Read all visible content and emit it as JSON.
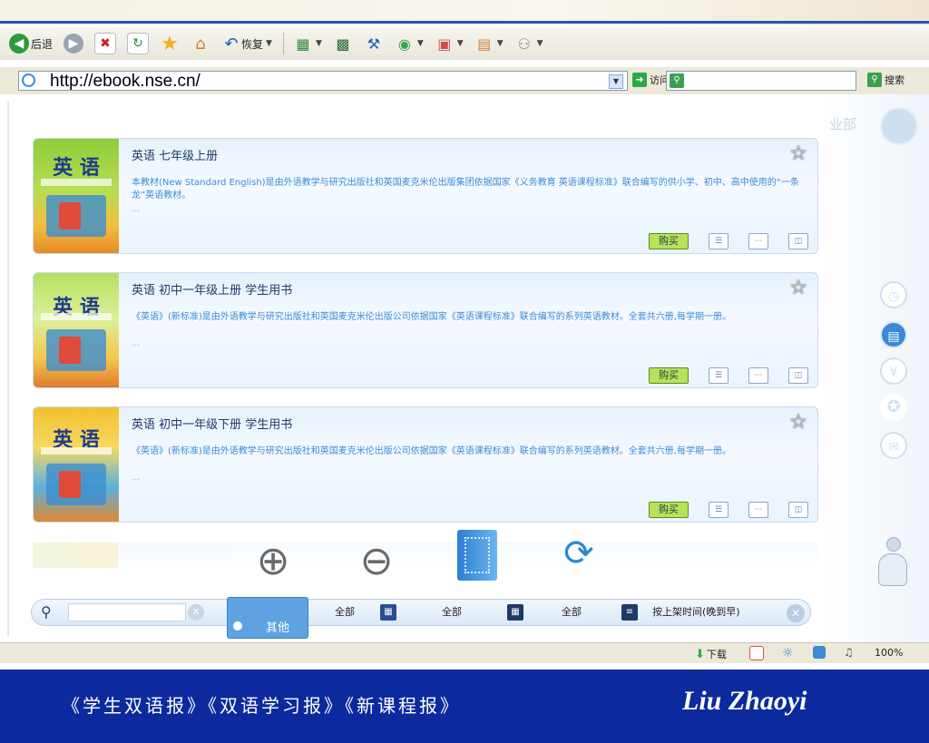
{
  "browser": {
    "toolbar": {
      "back_label": "后退",
      "restore_label": "恢复"
    },
    "address": {
      "url": "http://ebook.nse.cn/",
      "go_label": "访问",
      "search_label": "搜索"
    }
  },
  "page": {
    "books": [
      {
        "title": "英语 七年级上册",
        "cover_title": "英 语",
        "desc": "本教材(New Standard English)是由外语教学与研究出版社和英国麦克米伦出版集团依据国家《义务教育 英语课程标准》联合编写的供小学、初中、高中使用的“一条龙”英语教材。",
        "more": "...",
        "buy_label": "购买"
      },
      {
        "title": "英语 初中一年级上册 学生用书",
        "cover_title": "英 语",
        "desc": "《英语》(新标准)是由外语教学与研究出版社和英国麦克米伦出版公司依据国家《英语课程标准》联合编写的系列英语教材。全套共六册,每学期一册。",
        "more": "...",
        "buy_label": "购买"
      },
      {
        "title": "英语 初中一年级下册 学生用书",
        "cover_title": "英 语",
        "desc": "《英语》(新标准)是由外语教学与研究出版社和英国麦克米伦出版公司依据国家《英语课程标准》联合编写的系列英语教材。全套共六册,每学期一册。",
        "more": "...",
        "buy_label": "购买"
      }
    ],
    "brand_text": "业部"
  },
  "filter_bar": {
    "popup_option": "其他",
    "filter_1": "全部",
    "filter_2": "全部",
    "filter_3": "全部",
    "sort_label": "按上架时间(晚到早)"
  },
  "status": {
    "download_label": "下载",
    "zoom": "100%"
  },
  "footer": {
    "papers": "《学生双语报》《双语学习报》《新课程报》",
    "author": "Liu Zhaoyi"
  },
  "colors": {
    "footer_bg": "#0c2a9e",
    "accent": "#3a8ad6",
    "buy_green": "#b7e25a"
  }
}
